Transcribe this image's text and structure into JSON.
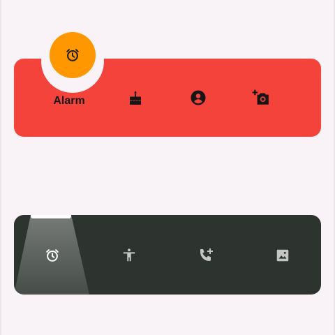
{
  "top_nav": {
    "background_color": "#f4433b",
    "fab_color": "#ff9700",
    "selected_item": {
      "label": "Alarm",
      "icon": "alarm-clock-icon"
    },
    "items": [
      {
        "icon": "cake-icon"
      },
      {
        "icon": "account-circle-icon"
      },
      {
        "icon": "add-a-photo-icon"
      }
    ]
  },
  "bottom_nav": {
    "background_color": "#2d342f",
    "selected_index": 0,
    "items": [
      {
        "icon": "alarm-clock-icon"
      },
      {
        "icon": "accessibility-icon"
      },
      {
        "icon": "add-call-icon"
      },
      {
        "icon": "image-icon"
      }
    ]
  }
}
